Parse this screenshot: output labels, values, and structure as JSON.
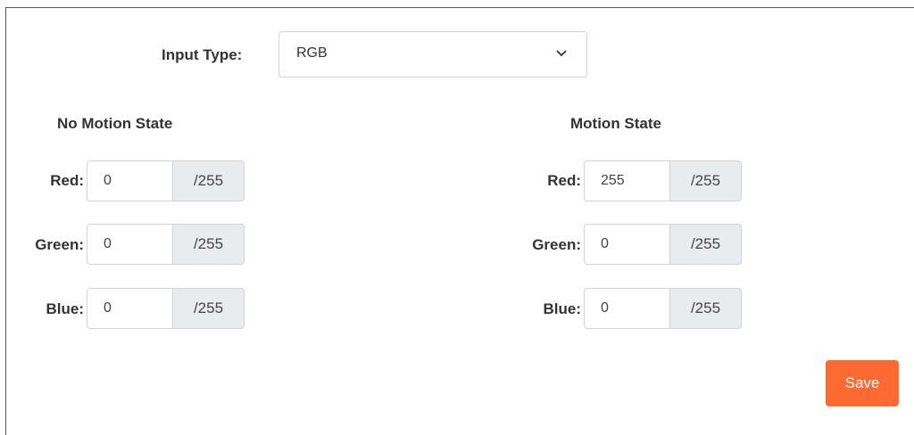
{
  "input_type": {
    "label": "Input Type:",
    "selected": "RGB",
    "icon": "chevron-down-icon"
  },
  "no_motion": {
    "title": "No Motion State",
    "rows": [
      {
        "label": "Red:",
        "value": "0",
        "suffix": "/255"
      },
      {
        "label": "Green:",
        "value": "0",
        "suffix": "/255"
      },
      {
        "label": "Blue:",
        "value": "0",
        "suffix": "/255"
      }
    ]
  },
  "motion": {
    "title": "Motion State",
    "rows": [
      {
        "label": "Red:",
        "value": "255",
        "suffix": "/255"
      },
      {
        "label": "Green:",
        "value": "0",
        "suffix": "/255"
      },
      {
        "label": "Blue:",
        "value": "0",
        "suffix": "/255"
      }
    ]
  },
  "actions": {
    "save_label": "Save",
    "save_color": "#ff6a33"
  }
}
